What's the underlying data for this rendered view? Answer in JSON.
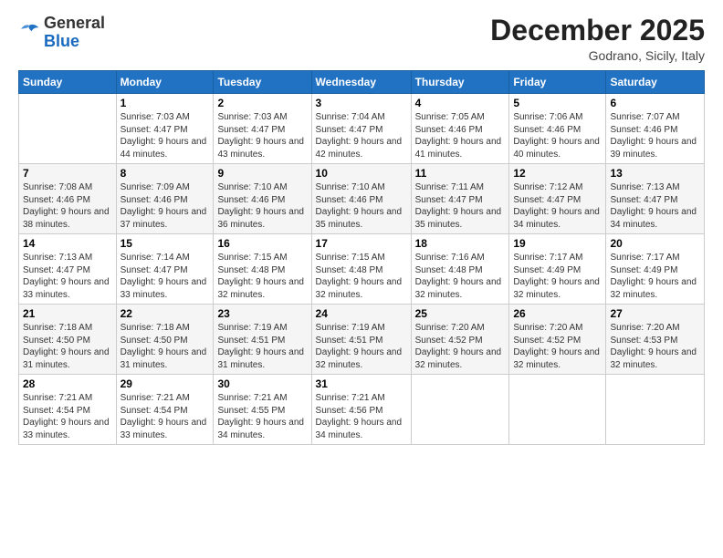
{
  "logo": {
    "general": "General",
    "blue": "Blue"
  },
  "header": {
    "month": "December 2025",
    "location": "Godrano, Sicily, Italy"
  },
  "weekdays": [
    "Sunday",
    "Monday",
    "Tuesday",
    "Wednesday",
    "Thursday",
    "Friday",
    "Saturday"
  ],
  "weeks": [
    [
      {
        "day": "",
        "sunrise": "",
        "sunset": "",
        "daylight": ""
      },
      {
        "day": "1",
        "sunrise": "Sunrise: 7:03 AM",
        "sunset": "Sunset: 4:47 PM",
        "daylight": "Daylight: 9 hours and 44 minutes."
      },
      {
        "day": "2",
        "sunrise": "Sunrise: 7:03 AM",
        "sunset": "Sunset: 4:47 PM",
        "daylight": "Daylight: 9 hours and 43 minutes."
      },
      {
        "day": "3",
        "sunrise": "Sunrise: 7:04 AM",
        "sunset": "Sunset: 4:47 PM",
        "daylight": "Daylight: 9 hours and 42 minutes."
      },
      {
        "day": "4",
        "sunrise": "Sunrise: 7:05 AM",
        "sunset": "Sunset: 4:46 PM",
        "daylight": "Daylight: 9 hours and 41 minutes."
      },
      {
        "day": "5",
        "sunrise": "Sunrise: 7:06 AM",
        "sunset": "Sunset: 4:46 PM",
        "daylight": "Daylight: 9 hours and 40 minutes."
      },
      {
        "day": "6",
        "sunrise": "Sunrise: 7:07 AM",
        "sunset": "Sunset: 4:46 PM",
        "daylight": "Daylight: 9 hours and 39 minutes."
      }
    ],
    [
      {
        "day": "7",
        "sunrise": "Sunrise: 7:08 AM",
        "sunset": "Sunset: 4:46 PM",
        "daylight": "Daylight: 9 hours and 38 minutes."
      },
      {
        "day": "8",
        "sunrise": "Sunrise: 7:09 AM",
        "sunset": "Sunset: 4:46 PM",
        "daylight": "Daylight: 9 hours and 37 minutes."
      },
      {
        "day": "9",
        "sunrise": "Sunrise: 7:10 AM",
        "sunset": "Sunset: 4:46 PM",
        "daylight": "Daylight: 9 hours and 36 minutes."
      },
      {
        "day": "10",
        "sunrise": "Sunrise: 7:10 AM",
        "sunset": "Sunset: 4:46 PM",
        "daylight": "Daylight: 9 hours and 35 minutes."
      },
      {
        "day": "11",
        "sunrise": "Sunrise: 7:11 AM",
        "sunset": "Sunset: 4:47 PM",
        "daylight": "Daylight: 9 hours and 35 minutes."
      },
      {
        "day": "12",
        "sunrise": "Sunrise: 7:12 AM",
        "sunset": "Sunset: 4:47 PM",
        "daylight": "Daylight: 9 hours and 34 minutes."
      },
      {
        "day": "13",
        "sunrise": "Sunrise: 7:13 AM",
        "sunset": "Sunset: 4:47 PM",
        "daylight": "Daylight: 9 hours and 34 minutes."
      }
    ],
    [
      {
        "day": "14",
        "sunrise": "Sunrise: 7:13 AM",
        "sunset": "Sunset: 4:47 PM",
        "daylight": "Daylight: 9 hours and 33 minutes."
      },
      {
        "day": "15",
        "sunrise": "Sunrise: 7:14 AM",
        "sunset": "Sunset: 4:47 PM",
        "daylight": "Daylight: 9 hours and 33 minutes."
      },
      {
        "day": "16",
        "sunrise": "Sunrise: 7:15 AM",
        "sunset": "Sunset: 4:48 PM",
        "daylight": "Daylight: 9 hours and 32 minutes."
      },
      {
        "day": "17",
        "sunrise": "Sunrise: 7:15 AM",
        "sunset": "Sunset: 4:48 PM",
        "daylight": "Daylight: 9 hours and 32 minutes."
      },
      {
        "day": "18",
        "sunrise": "Sunrise: 7:16 AM",
        "sunset": "Sunset: 4:48 PM",
        "daylight": "Daylight: 9 hours and 32 minutes."
      },
      {
        "day": "19",
        "sunrise": "Sunrise: 7:17 AM",
        "sunset": "Sunset: 4:49 PM",
        "daylight": "Daylight: 9 hours and 32 minutes."
      },
      {
        "day": "20",
        "sunrise": "Sunrise: 7:17 AM",
        "sunset": "Sunset: 4:49 PM",
        "daylight": "Daylight: 9 hours and 32 minutes."
      }
    ],
    [
      {
        "day": "21",
        "sunrise": "Sunrise: 7:18 AM",
        "sunset": "Sunset: 4:50 PM",
        "daylight": "Daylight: 9 hours and 31 minutes."
      },
      {
        "day": "22",
        "sunrise": "Sunrise: 7:18 AM",
        "sunset": "Sunset: 4:50 PM",
        "daylight": "Daylight: 9 hours and 31 minutes."
      },
      {
        "day": "23",
        "sunrise": "Sunrise: 7:19 AM",
        "sunset": "Sunset: 4:51 PM",
        "daylight": "Daylight: 9 hours and 31 minutes."
      },
      {
        "day": "24",
        "sunrise": "Sunrise: 7:19 AM",
        "sunset": "Sunset: 4:51 PM",
        "daylight": "Daylight: 9 hours and 32 minutes."
      },
      {
        "day": "25",
        "sunrise": "Sunrise: 7:20 AM",
        "sunset": "Sunset: 4:52 PM",
        "daylight": "Daylight: 9 hours and 32 minutes."
      },
      {
        "day": "26",
        "sunrise": "Sunrise: 7:20 AM",
        "sunset": "Sunset: 4:52 PM",
        "daylight": "Daylight: 9 hours and 32 minutes."
      },
      {
        "day": "27",
        "sunrise": "Sunrise: 7:20 AM",
        "sunset": "Sunset: 4:53 PM",
        "daylight": "Daylight: 9 hours and 32 minutes."
      }
    ],
    [
      {
        "day": "28",
        "sunrise": "Sunrise: 7:21 AM",
        "sunset": "Sunset: 4:54 PM",
        "daylight": "Daylight: 9 hours and 33 minutes."
      },
      {
        "day": "29",
        "sunrise": "Sunrise: 7:21 AM",
        "sunset": "Sunset: 4:54 PM",
        "daylight": "Daylight: 9 hours and 33 minutes."
      },
      {
        "day": "30",
        "sunrise": "Sunrise: 7:21 AM",
        "sunset": "Sunset: 4:55 PM",
        "daylight": "Daylight: 9 hours and 34 minutes."
      },
      {
        "day": "31",
        "sunrise": "Sunrise: 7:21 AM",
        "sunset": "Sunset: 4:56 PM",
        "daylight": "Daylight: 9 hours and 34 minutes."
      },
      {
        "day": "",
        "sunrise": "",
        "sunset": "",
        "daylight": ""
      },
      {
        "day": "",
        "sunrise": "",
        "sunset": "",
        "daylight": ""
      },
      {
        "day": "",
        "sunrise": "",
        "sunset": "",
        "daylight": ""
      }
    ]
  ]
}
